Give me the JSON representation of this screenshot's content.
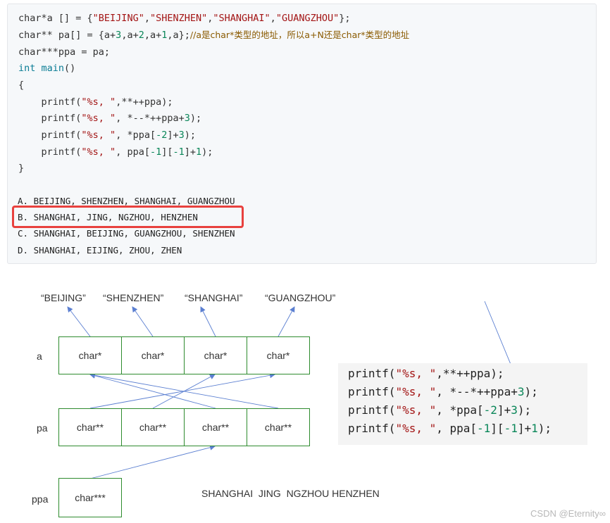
{
  "code": {
    "line1_p1": "char*a [] = {",
    "line1_s1": "\"BEIJING\"",
    "line1_s2": "\"SHENZHEN\"",
    "line1_s3": "\"SHANGHAI\"",
    "line1_s4": "\"GUANGZHOU\"",
    "line1_end": "};",
    "line2_p1": "char** pa[] = {a+",
    "line2_n1": "3",
    "line2_p2": ",a+",
    "line2_n2": "2",
    "line2_p3": ",a+",
    "line2_n3": "1",
    "line2_p4": ",a};",
    "line2_comment": "//a是char*类型的地址，所以a+N还是char*类型的地址",
    "line3": "char***ppa = pa;",
    "line4_kw": "int",
    "line4_fn": "main",
    "line4_end": "()",
    "line5": "{",
    "p1_a": "    printf(",
    "p1_s": "\"%s, \"",
    "p1_b": ",**++ppa);",
    "p2_a": "    printf(",
    "p2_s": "\"%s, \"",
    "p2_b": ", *--*++ppa+",
    "p2_n": "3",
    "p2_c": ");",
    "p3_a": "    printf(",
    "p3_s": "\"%s, \"",
    "p3_b": ", *ppa[",
    "p3_n1": "-2",
    "p3_c": "]+",
    "p3_n2": "3",
    "p3_d": ");",
    "p4_a": "    printf(",
    "p4_s": "\"%s, \"",
    "p4_b": ", ppa[",
    "p4_n1": "-1",
    "p4_c": "][",
    "p4_n2": "-1",
    "p4_d": "]+",
    "p4_n3": "1",
    "p4_e": ");",
    "line_close": "}"
  },
  "options": {
    "a": "A. BEIJING, SHENZHEN, SHANGHAI, GUANGZHOU",
    "b": "B. SHANGHAI, JING, NGZHOU, HENZHEN",
    "c": "C. SHANGHAI, BEIJING, GUANGZHOU, SHENZHEN",
    "d": "D. SHANGHAI, EIJING, ZHOU, ZHEN"
  },
  "diagram": {
    "strings": [
      "“BEIJING”",
      "“SHENZHEN”",
      "“SHANGHAI”",
      "“GUANGZHOU”"
    ],
    "label_a": "a",
    "label_pa": "pa",
    "label_ppa": "ppa",
    "a_cells": [
      "char*",
      "char*",
      "char*",
      "char*"
    ],
    "pa_cells": [
      "char**",
      "char**",
      "char**",
      "char**"
    ],
    "ppa_cell": "char***",
    "result": "SHANGHAI  JING  NGZHOU HENZHEN"
  },
  "panel": {
    "l1_a": "printf(",
    "l1_s": "\"%s, \"",
    "l1_b": ",**++ppa);",
    "l2_a": "printf(",
    "l2_s": "\"%s, \"",
    "l2_b": ", *--*++ppa+",
    "l2_n": "3",
    "l2_c": ");",
    "l3_a": "printf(",
    "l3_s": "\"%s, \"",
    "l3_b": ", *ppa[",
    "l3_n1": "-2",
    "l3_c": "]+",
    "l3_n2": "3",
    "l3_d": ");",
    "l4_a": "printf(",
    "l4_s": "\"%s, \"",
    "l4_b": ", ppa[",
    "l4_n1": "-1",
    "l4_c": "][",
    "l4_n2": "-1",
    "l4_d": "]+",
    "l4_n3": "1",
    "l4_e": ");"
  },
  "watermark": "CSDN @Eternity∞",
  "colors": {
    "box_border": "#2e8b2e",
    "arrow": "#5b7fd1",
    "highlight": "#e8413e"
  }
}
